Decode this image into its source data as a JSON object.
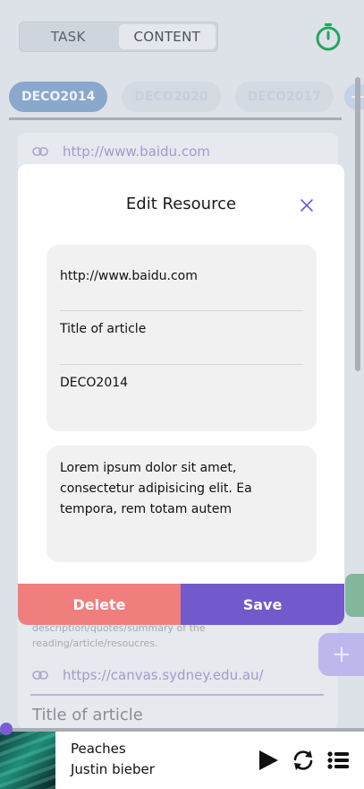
{
  "header": {
    "tabs": [
      {
        "label": "TASK",
        "active": false
      },
      {
        "label": "CONTENT",
        "active": true
      }
    ],
    "timer_icon": "stopwatch-icon"
  },
  "course_chips": [
    {
      "label": "DECO2014",
      "active": true
    },
    {
      "label": "DECO2020",
      "active": false
    },
    {
      "label": "DECO2017",
      "active": false
    }
  ],
  "background_list": {
    "top_link": "http://www.baidu.com",
    "description": "description/quotes/summary of the reading/article/resoucres.",
    "second_link": "https://canvas.sydney.edu.au/",
    "second_title": "Title of article"
  },
  "modal": {
    "title": "Edit Resource",
    "url_value": "http://www.baidu.com",
    "title_value": "Title of article",
    "course_value": "DECO2014",
    "notes_value": "Lorem ipsum dolor sit amet, consectetur adipisicing elit. Ea tempora, rem totam autem",
    "delete_label": "Delete",
    "save_label": "Save"
  },
  "player": {
    "track_title": "Peaches",
    "artist": "Justin bieber",
    "progress": 0.0
  },
  "colors": {
    "accent": "#7259cc",
    "danger": "#f07e7c",
    "timer": "#27a65d"
  }
}
